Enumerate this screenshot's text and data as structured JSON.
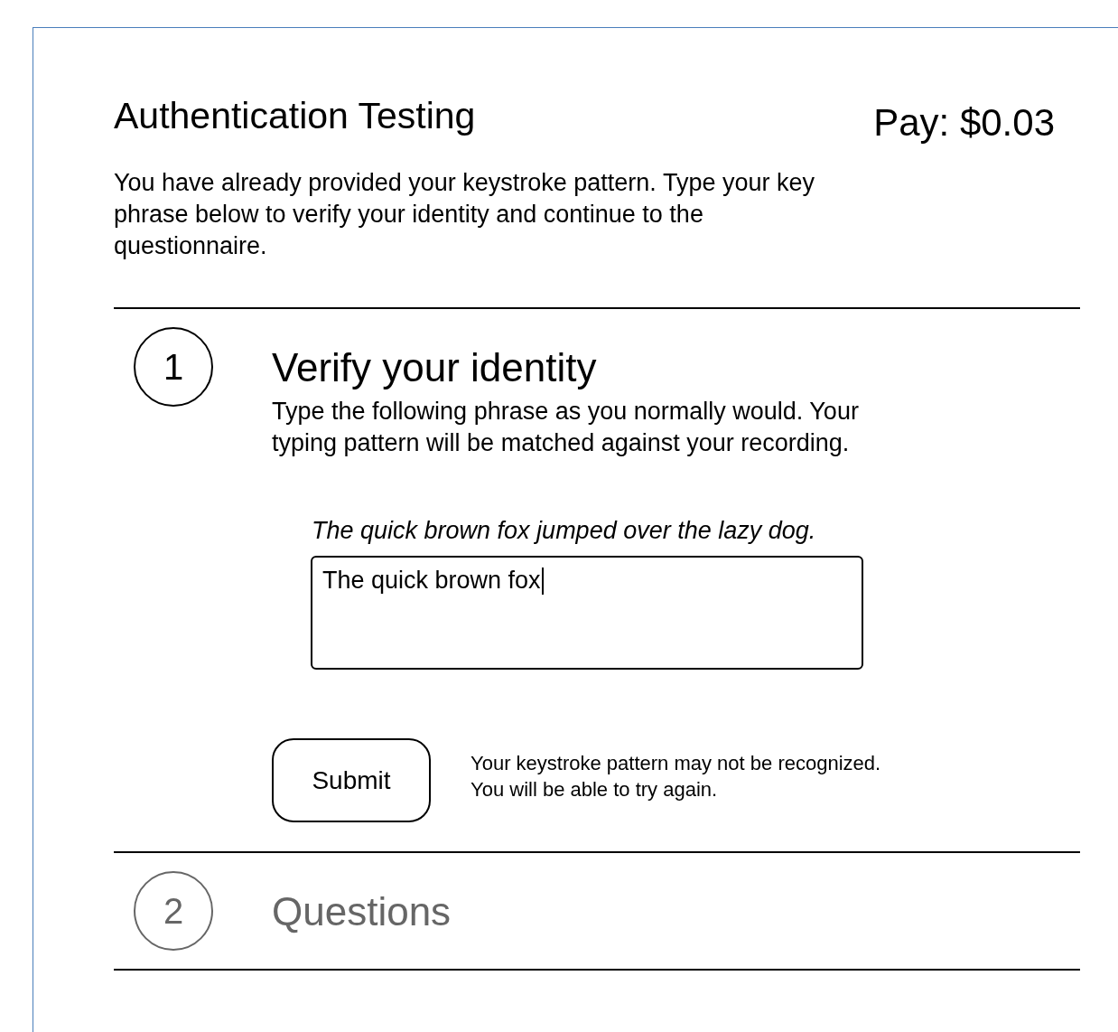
{
  "header": {
    "title": "Authentication Testing",
    "pay": "Pay: $0.03"
  },
  "intro": "You have already provided your keystroke pattern. Type your key phrase below to verify your identity and continue to the questionnaire.",
  "steps": [
    {
      "number": "1",
      "title": "Verify your identity",
      "active": true,
      "description": "Type the following phrase as you normally would. Your typing pattern will be matched against your recording.",
      "phrase": "The quick brown fox jumped over the lazy dog.",
      "field": {
        "value": "The quick brown fox"
      },
      "submit": "Submit",
      "note": [
        "Your keystroke pattern may not be recognized.",
        "You will be able to try again."
      ]
    },
    {
      "number": "2",
      "title": "Questions",
      "active": false
    }
  ]
}
